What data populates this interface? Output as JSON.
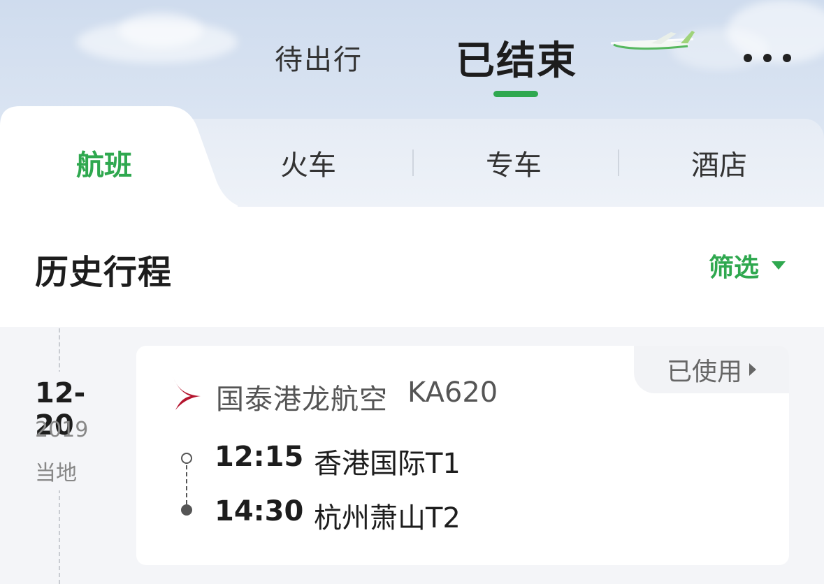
{
  "header": {
    "tabs": [
      {
        "label": "待出行",
        "active": false
      },
      {
        "label": "已结束",
        "active": true
      }
    ],
    "more_icon": "more-dots-icon",
    "accent_color": "#2fa84f"
  },
  "categories": [
    {
      "label": "航班",
      "active": true
    },
    {
      "label": "火车",
      "active": false
    },
    {
      "label": "专车",
      "active": false
    },
    {
      "label": "酒店",
      "active": false
    }
  ],
  "section": {
    "title": "历史行程",
    "filter_label": "筛选"
  },
  "trips": [
    {
      "date": "12-20",
      "year": "2019",
      "timezone_label": "当地",
      "status": "已使用",
      "airline": "国泰港龙航空",
      "flight_no": "KA620",
      "departure": {
        "time": "12:15",
        "airport": "香港国际T1"
      },
      "arrival": {
        "time": "14:30",
        "airport": "杭州萧山T2"
      }
    }
  ]
}
